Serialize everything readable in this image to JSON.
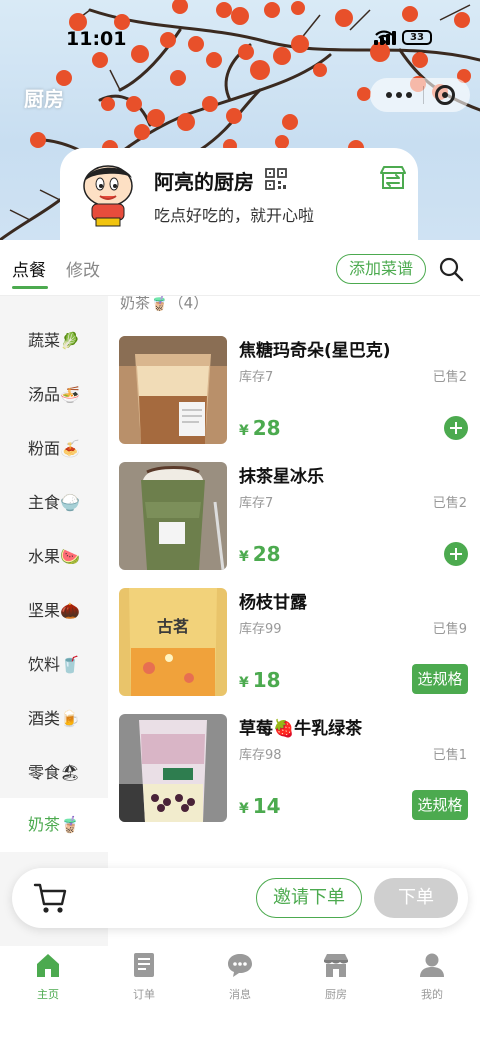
{
  "status_bar": {
    "time": "11:01",
    "battery": "33"
  },
  "banner": {
    "title": "厨房"
  },
  "shop": {
    "name": "阿亮的厨房",
    "slogan": "吃点好吃的，就开心啦"
  },
  "tabs": {
    "order": "点餐",
    "edit": "修改",
    "add_menu": "添加菜谱"
  },
  "categories": [
    {
      "label": "蔬菜",
      "emoji": "🥬"
    },
    {
      "label": "汤品",
      "emoji": "🍜"
    },
    {
      "label": "粉面",
      "emoji": "🍝"
    },
    {
      "label": "主食",
      "emoji": "🍚"
    },
    {
      "label": "水果",
      "emoji": "🍉"
    },
    {
      "label": "坚果",
      "emoji": "🌰"
    },
    {
      "label": "饮料",
      "emoji": "🥤"
    },
    {
      "label": "酒类",
      "emoji": "🍺"
    },
    {
      "label": "零食",
      "emoji": "🏖"
    },
    {
      "label": "奶茶",
      "emoji": "🧋"
    }
  ],
  "active_category": "奶茶",
  "section": {
    "title": "奶茶🧋（4）"
  },
  "products": [
    {
      "name": "焦糖玛奇朵(星巴克)",
      "stock": "库存7",
      "sold": "已售2",
      "currency": "¥",
      "price": "28",
      "action": "plus"
    },
    {
      "name": "抹茶星冰乐",
      "stock": "库存7",
      "sold": "已售2",
      "currency": "¥",
      "price": "28",
      "action": "plus"
    },
    {
      "name": "杨枝甘露",
      "stock": "库存99",
      "sold": "已售9",
      "currency": "¥",
      "price": "18",
      "action": "spec",
      "spec_label": "选规格"
    },
    {
      "name": "草莓🍓牛乳绿茶",
      "stock": "库存98",
      "sold": "已售1",
      "currency": "¥",
      "price": "14",
      "action": "spec",
      "spec_label": "选规格"
    }
  ],
  "cart": {
    "invite": "邀请下单",
    "order": "下单"
  },
  "bottom_nav": [
    {
      "label": "主页",
      "icon": "home-icon"
    },
    {
      "label": "订单",
      "icon": "orders-icon"
    },
    {
      "label": "消息",
      "icon": "message-icon"
    },
    {
      "label": "厨房",
      "icon": "kitchen-icon"
    },
    {
      "label": "我的",
      "icon": "profile-icon"
    }
  ],
  "colors": {
    "accent": "#4caa4f",
    "disabled": "#cfcfcf",
    "sidebar_bg": "#f5f5f5"
  }
}
